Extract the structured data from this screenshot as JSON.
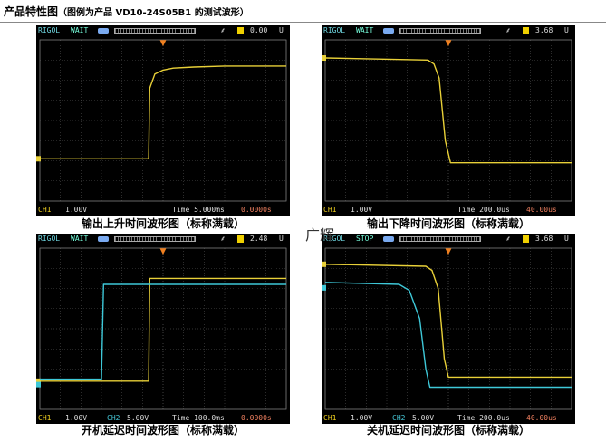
{
  "header": {
    "title": "产品特性图",
    "subtitle": "（图例为产品 VD10-24S05B1 的测试波形）"
  },
  "watermark": "广辉",
  "colors": {
    "ch1": "#e8d038",
    "ch2": "#3ec8d8",
    "grid": "#4a4a4a",
    "screen": "#000000"
  },
  "chart_data": [
    {
      "type": "line",
      "caption": "输出上升时间波形图（标称满载）",
      "topbar": {
        "brand": "RIGOL",
        "status": "WAIT",
        "trigger_value": "0.00",
        "unit": "U"
      },
      "botbar": {
        "ch1": "CH1",
        "ch1_scale": "1.00V",
        "time": "Time 5.000ms",
        "offset": "0.0000s"
      },
      "grid": true,
      "divisions": [
        12,
        8
      ],
      "ylim": [
        0,
        8
      ],
      "xlim": [
        0,
        12
      ],
      "series": [
        {
          "channel": "CH1",
          "color": "#e8d038",
          "x": [
            0,
            5.3,
            5.35,
            5.6,
            6.0,
            6.5,
            7.5,
            9,
            12
          ],
          "y": [
            2.1,
            2.1,
            5.6,
            6.3,
            6.5,
            6.6,
            6.65,
            6.7,
            6.7
          ]
        }
      ]
    },
    {
      "type": "line",
      "caption": "输出下降时间波形图（标称满载）",
      "topbar": {
        "brand": "RIGOL",
        "status": "WAIT",
        "trigger_value": "3.68",
        "unit": "U"
      },
      "botbar": {
        "ch1": "CH1",
        "ch1_scale": "1.00V",
        "time": "Time 200.0us",
        "offset": "40.00us"
      },
      "grid": true,
      "divisions": [
        12,
        8
      ],
      "ylim": [
        0,
        8
      ],
      "xlim": [
        0,
        12
      ],
      "series": [
        {
          "channel": "CH1",
          "color": "#e8d038",
          "x": [
            0,
            5.0,
            5.3,
            5.55,
            5.85,
            6.1,
            12
          ],
          "y": [
            7.1,
            7.0,
            6.8,
            6.1,
            3.0,
            1.9,
            1.9
          ]
        }
      ]
    },
    {
      "type": "line",
      "caption": "开机延迟时间波形图（标称满载）",
      "topbar": {
        "brand": "RIGOL",
        "status": "WAIT",
        "trigger_value": "2.48",
        "unit": "U"
      },
      "botbar": {
        "ch1": "CH1",
        "ch1_scale": "1.00V",
        "ch2": "CH2",
        "ch2_scale": "5.00V",
        "time": "Time 100.0ms",
        "offset": "0.0000s"
      },
      "grid": true,
      "divisions": [
        12,
        8
      ],
      "ylim": [
        0,
        8
      ],
      "xlim": [
        0,
        12
      ],
      "series": [
        {
          "channel": "CH1",
          "color": "#e8d038",
          "x": [
            0,
            5.3,
            5.35,
            12
          ],
          "y": [
            1.4,
            1.4,
            6.5,
            6.5
          ]
        },
        {
          "channel": "CH2",
          "color": "#3ec8d8",
          "x": [
            0,
            3.0,
            3.1,
            12
          ],
          "y": [
            1.5,
            1.5,
            6.2,
            6.2
          ]
        }
      ]
    },
    {
      "type": "line",
      "caption": "关机延迟时间波形图（标称满载）",
      "topbar": {
        "brand": "RIGOL",
        "status": "STOP",
        "trigger_value": "3.68",
        "unit": "U"
      },
      "botbar": {
        "ch1": "CH1",
        "ch1_scale": "1.00V",
        "ch2": "CH2",
        "ch2_scale": "5.00V",
        "time": "Time 200.0us",
        "offset": "40.00us"
      },
      "grid": true,
      "divisions": [
        12,
        8
      ],
      "ylim": [
        0,
        8
      ],
      "xlim": [
        0,
        12
      ],
      "series": [
        {
          "channel": "CH1",
          "color": "#e8d038",
          "x": [
            0,
            4.9,
            5.2,
            5.5,
            5.8,
            6.0,
            12
          ],
          "y": [
            7.2,
            7.1,
            6.9,
            6.0,
            2.5,
            1.6,
            1.6
          ]
        },
        {
          "channel": "CH2",
          "color": "#3ec8d8",
          "x": [
            0,
            3.6,
            4.1,
            4.6,
            4.9,
            5.1,
            12
          ],
          "y": [
            6.3,
            6.2,
            5.9,
            4.5,
            2.0,
            1.1,
            1.1
          ]
        }
      ]
    }
  ]
}
